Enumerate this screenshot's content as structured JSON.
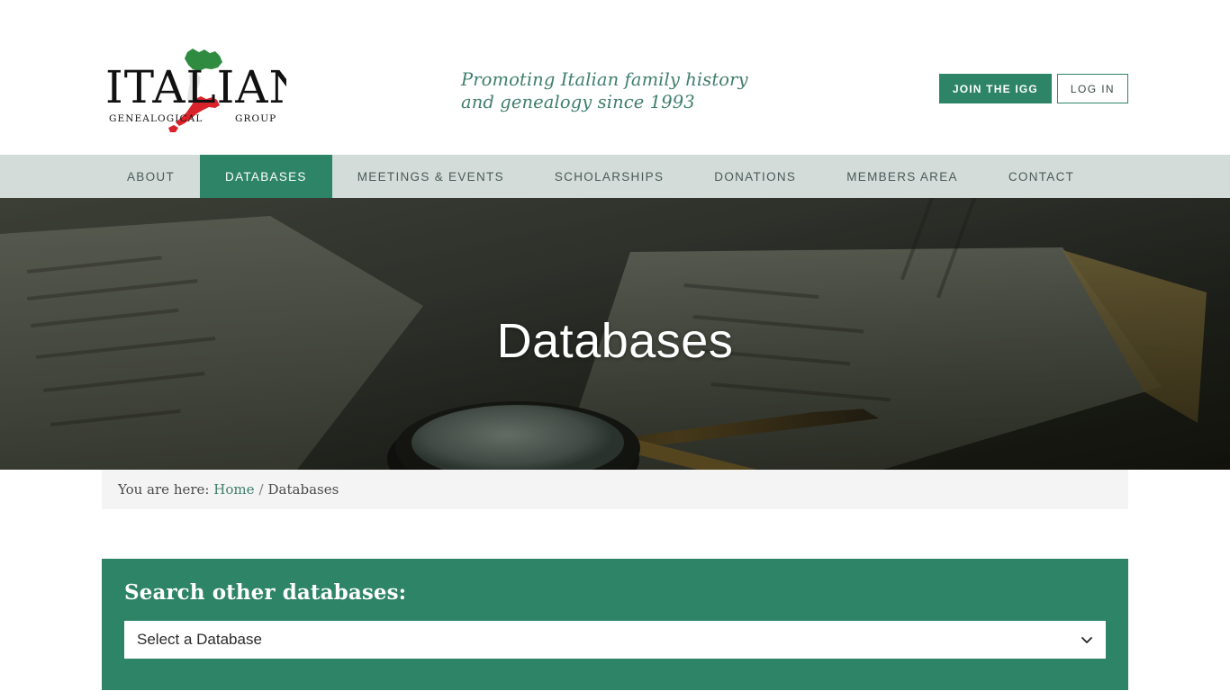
{
  "header": {
    "logo": {
      "name": "italian-genealogical-group-logo",
      "main_text": "ITALIAN",
      "sub_left": "GENEALOGICAL",
      "sub_right": "GROUP",
      "map_green": "#2e8b3f",
      "map_red": "#d8232a"
    },
    "tagline_line1": "Promoting Italian family history",
    "tagline_line2": "and genealogy since 1993",
    "join_button": "JOIN THE IGG",
    "login_button": "LOG IN"
  },
  "nav": {
    "items": [
      {
        "label": "ABOUT",
        "active": false
      },
      {
        "label": "DATABASES",
        "active": true
      },
      {
        "label": "MEETINGS & EVENTS",
        "active": false
      },
      {
        "label": "SCHOLARSHIPS",
        "active": false
      },
      {
        "label": "DONATIONS",
        "active": false
      },
      {
        "label": "MEMBERS AREA",
        "active": false
      },
      {
        "label": "CONTACT",
        "active": false
      }
    ]
  },
  "hero": {
    "title": "Databases"
  },
  "breadcrumb": {
    "prefix": "You are here:",
    "home": "Home",
    "separator": "/",
    "current": "Databases"
  },
  "search_panel": {
    "heading": "Search other databases:",
    "select_value": "Select a Database",
    "chevron_icon": "chevron-down-icon"
  },
  "colors": {
    "brand_green": "#2e8466",
    "nav_bg": "#d3dcd9",
    "tagline_green": "#3f7e6c",
    "breadcrumb_bg": "#f4f4f4"
  }
}
